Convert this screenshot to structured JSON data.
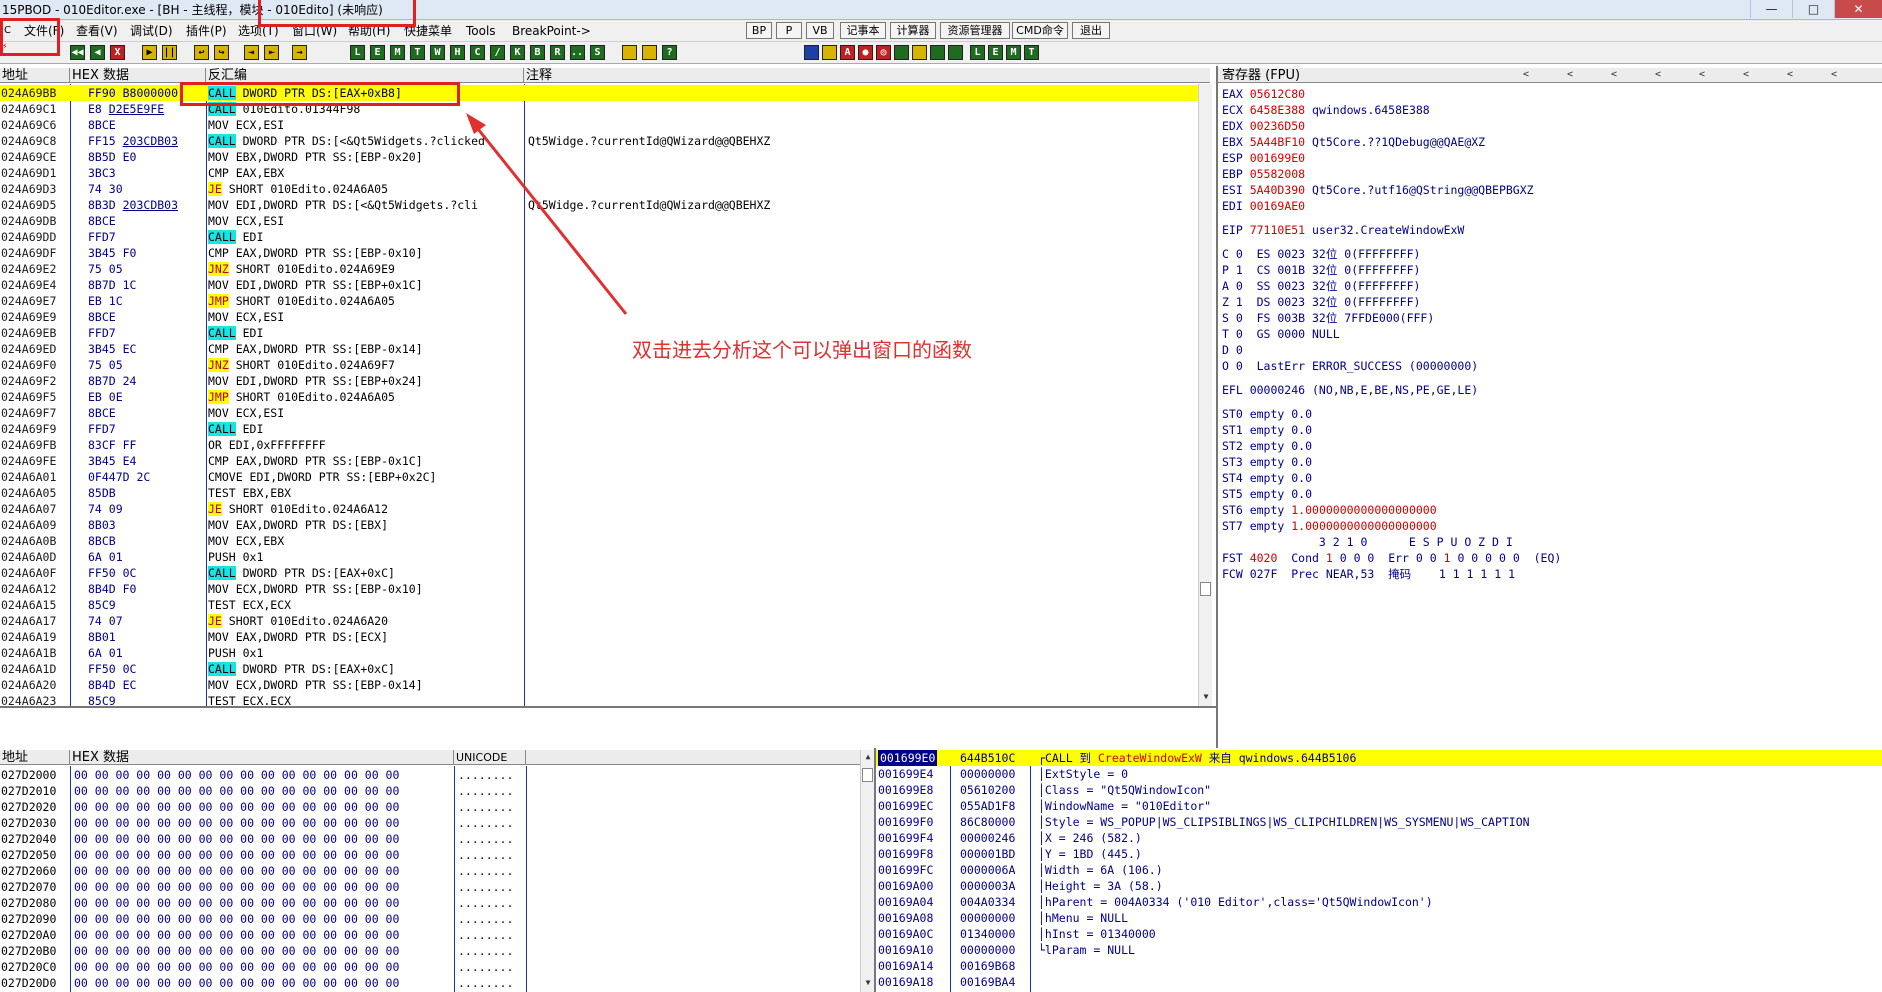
{
  "titlebar": {
    "app": "15PBOD",
    "text": " - 010Editor.exe - [BH - 主线程，模块 - 010Edito] (未响应)",
    "win_min": "—",
    "win_max": "□",
    "win_close": "✕"
  },
  "menu": {
    "items": [
      "文件(F)",
      "查看(V)",
      "调试(D)",
      "插件(P)",
      "选项(T)",
      "窗口(W)",
      "帮助(H)",
      "快捷菜单",
      "Tools",
      "BreakPoint->"
    ],
    "quick": [
      "BP",
      "P",
      "VB",
      "记事本",
      "计算器",
      "资源管理器",
      "CMD命令",
      "退出"
    ]
  },
  "toolbar": {
    "left": [
      "◀◀",
      "◀",
      "X",
      "▶",
      "||",
      "↩",
      "↪",
      "⇥",
      "⇤",
      "→"
    ],
    "letters": [
      "L",
      "E",
      "M",
      "T",
      "W",
      "H",
      "C",
      "/",
      "K",
      "B",
      "R",
      "...",
      "S"
    ]
  },
  "cpu": {
    "headers": {
      "addr": "地址",
      "hex": "HEX 数据",
      "asm": "反汇编",
      "cmt": "注释"
    },
    "rows": [
      {
        "a": "024A69BB",
        "h": "FF90 B8000000",
        "p": "CALL",
        "r": " DWORD PTR DS:[EAX+0xB8]",
        "c": "",
        "sel": true
      },
      {
        "a": "024A69C1",
        "h": "E8 D2E5E9FE",
        "p": "CALL",
        "r": " 010Edito.01344F98",
        "c": ""
      },
      {
        "a": "024A69C6",
        "h": "8BCE",
        "p": "",
        "r": "MOV ECX,ESI",
        "c": ""
      },
      {
        "a": "024A69C8",
        "h": "FF15 203CDB03",
        "p": "CALL",
        "r": " DWORD PTR DS:[<&Qt5Widgets.?clicked",
        "c": "Qt5Widge.?currentId@QWizard@@QBEHXZ"
      },
      {
        "a": "024A69CE",
        "h": "8B5D E0",
        "p": "",
        "r": "MOV EBX,DWORD PTR SS:[EBP-0x20]",
        "c": ""
      },
      {
        "a": "024A69D1",
        "h": "3BC3",
        "p": "",
        "r": "CMP EAX,EBX",
        "c": ""
      },
      {
        "a": "024A69D3",
        "h": "74 30",
        "p": "JE",
        "r": " SHORT 010Edito.024A6A05",
        "c": ""
      },
      {
        "a": "024A69D5",
        "h": "8B3D 203CDB03",
        "p": "",
        "r": "MOV EDI,DWORD PTR DS:[<&Qt5Widgets.?cli",
        "c": "Qt5Widge.?currentId@QWizard@@QBEHXZ"
      },
      {
        "a": "024A69DB",
        "h": "8BCE",
        "p": "",
        "r": "MOV ECX,ESI",
        "c": ""
      },
      {
        "a": "024A69DD",
        "h": "FFD7",
        "p": "CALL",
        "r": " EDI",
        "c": ""
      },
      {
        "a": "024A69DF",
        "h": "3B45 F0",
        "p": "",
        "r": "CMP EAX,DWORD PTR SS:[EBP-0x10]",
        "c": ""
      },
      {
        "a": "024A69E2",
        "h": "75 05",
        "p": "JNZ",
        "r": " SHORT 010Edito.024A69E9",
        "c": ""
      },
      {
        "a": "024A69E4",
        "h": "8B7D 1C",
        "p": "",
        "r": "MOV EDI,DWORD PTR SS:[EBP+0x1C]",
        "c": ""
      },
      {
        "a": "024A69E7",
        "h": "EB 1C",
        "p": "JMP",
        "r": " SHORT 010Edito.024A6A05",
        "c": ""
      },
      {
        "a": "024A69E9",
        "h": "8BCE",
        "p": "",
        "r": "MOV ECX,ESI",
        "c": ""
      },
      {
        "a": "024A69EB",
        "h": "FFD7",
        "p": "CALL",
        "r": " EDI",
        "c": ""
      },
      {
        "a": "024A69ED",
        "h": "3B45 EC",
        "p": "",
        "r": "CMP EAX,DWORD PTR SS:[EBP-0x14]",
        "c": ""
      },
      {
        "a": "024A69F0",
        "h": "75 05",
        "p": "JNZ",
        "r": " SHORT 010Edito.024A69F7",
        "c": ""
      },
      {
        "a": "024A69F2",
        "h": "8B7D 24",
        "p": "",
        "r": "MOV EDI,DWORD PTR SS:[EBP+0x24]",
        "c": ""
      },
      {
        "a": "024A69F5",
        "h": "EB 0E",
        "p": "JMP",
        "r": " SHORT 010Edito.024A6A05",
        "c": ""
      },
      {
        "a": "024A69F7",
        "h": "8BCE",
        "p": "",
        "r": "MOV ECX,ESI",
        "c": ""
      },
      {
        "a": "024A69F9",
        "h": "FFD7",
        "p": "CALL",
        "r": " EDI",
        "c": ""
      },
      {
        "a": "024A69FB",
        "h": "83CF FF",
        "p": "",
        "r": "OR EDI,0xFFFFFFFF",
        "c": ""
      },
      {
        "a": "024A69FE",
        "h": "3B45 E4",
        "p": "",
        "r": "CMP EAX,DWORD PTR SS:[EBP-0x1C]",
        "c": ""
      },
      {
        "a": "024A6A01",
        "h": "0F447D 2C",
        "p": "",
        "r": "CMOVE EDI,DWORD PTR SS:[EBP+0x2C]",
        "c": ""
      },
      {
        "a": "024A6A05",
        "h": "85DB",
        "p": "",
        "r": "TEST EBX,EBX",
        "c": ""
      },
      {
        "a": "024A6A07",
        "h": "74 09",
        "p": "JE",
        "r": " SHORT 010Edito.024A6A12",
        "c": ""
      },
      {
        "a": "024A6A09",
        "h": "8B03",
        "p": "",
        "r": "MOV EAX,DWORD PTR DS:[EBX]",
        "c": ""
      },
      {
        "a": "024A6A0B",
        "h": "8BCB",
        "p": "",
        "r": "MOV ECX,EBX",
        "c": ""
      },
      {
        "a": "024A6A0D",
        "h": "6A 01",
        "p": "",
        "r": "PUSH 0x1",
        "c": ""
      },
      {
        "a": "024A6A0F",
        "h": "FF50 0C",
        "p": "CALL",
        "r": " DWORD PTR DS:[EAX+0xC]",
        "c": ""
      },
      {
        "a": "024A6A12",
        "h": "8B4D F0",
        "p": "",
        "r": "MOV ECX,DWORD PTR SS:[EBP-0x10]",
        "c": ""
      },
      {
        "a": "024A6A15",
        "h": "85C9",
        "p": "",
        "r": "TEST ECX,ECX",
        "c": ""
      },
      {
        "a": "024A6A17",
        "h": "74 07",
        "p": "JE",
        "r": " SHORT 010Edito.024A6A20",
        "c": ""
      },
      {
        "a": "024A6A19",
        "h": "8B01",
        "p": "",
        "r": "MOV EAX,DWORD PTR DS:[ECX]",
        "c": ""
      },
      {
        "a": "024A6A1B",
        "h": "6A 01",
        "p": "",
        "r": "PUSH 0x1",
        "c": ""
      },
      {
        "a": "024A6A1D",
        "h": "FF50 0C",
        "p": "CALL",
        "r": " DWORD PTR DS:[EAX+0xC]",
        "c": ""
      },
      {
        "a": "024A6A20",
        "h": "8B4D EC",
        "p": "",
        "r": "MOV ECX,DWORD PTR SS:[EBP-0x14]",
        "c": ""
      },
      {
        "a": "024A6A23",
        "h": "85C9",
        "p": "",
        "r": "TEST ECX,ECX",
        "c": ""
      }
    ]
  },
  "annotation": "双击进去分析这个可以弹出窗口的函数",
  "registers": {
    "title": "寄存器 (FPU)",
    "nav": [
      "<",
      "<",
      "<",
      "<",
      "<",
      "<",
      "<",
      "<"
    ],
    "gp": [
      {
        "n": "EAX",
        "v": "05612C80",
        "d": ""
      },
      {
        "n": "ECX",
        "v": "6458E388",
        "d": "qwindows.6458E388"
      },
      {
        "n": "EDX",
        "v": "00236D50",
        "d": ""
      },
      {
        "n": "EBX",
        "v": "5A44BF10",
        "d": "Qt5Core.??1QDebug@@QAE@XZ"
      },
      {
        "n": "ESP",
        "v": "001699E0",
        "d": ""
      },
      {
        "n": "EBP",
        "v": "05582008",
        "d": ""
      },
      {
        "n": "ESI",
        "v": "5A40D390",
        "d": "Qt5Core.?utf16@QString@@QBEPBGXZ"
      },
      {
        "n": "EDI",
        "v": "00169AE0",
        "d": ""
      }
    ],
    "eip": {
      "n": "EIP",
      "v": "77110E51",
      "d": "user32.CreateWindowExW"
    },
    "seg": [
      "C 0  ES 0023 32位 0(FFFFFFFF)",
      "P 1  CS 001B 32位 0(FFFFFFFF)",
      "A 0  SS 0023 32位 0(FFFFFFFF)",
      "Z 1  DS 0023 32位 0(FFFFFFFF)",
      "S 0  FS 003B 32位 7FFDE000(FFF)",
      "T 0  GS 0000 NULL",
      "D 0",
      "O 0  LastErr ERROR_SUCCESS (00000000)"
    ],
    "efl": "EFL 00000246 (NO,NB,E,BE,NS,PE,GE,LE)",
    "fpu": [
      {
        "n": "ST0",
        "s": "empty",
        "v": "0.0",
        "red": false
      },
      {
        "n": "ST1",
        "s": "empty",
        "v": "0.0",
        "red": false
      },
      {
        "n": "ST2",
        "s": "empty",
        "v": "0.0",
        "red": false
      },
      {
        "n": "ST3",
        "s": "empty",
        "v": "0.0",
        "red": false
      },
      {
        "n": "ST4",
        "s": "empty",
        "v": "0.0",
        "red": false
      },
      {
        "n": "ST5",
        "s": "empty",
        "v": "0.0",
        "red": false
      },
      {
        "n": "ST6",
        "s": "empty",
        "v": "1.0000000000000000000",
        "red": true
      },
      {
        "n": "ST7",
        "s": "empty",
        "v": "1.0000000000000000000",
        "red": true
      }
    ],
    "fbits": "              3 2 1 0      E S P U O Z D I",
    "fst": {
      "pre": "FST ",
      "v": "4020",
      "mid": "  Cond ",
      "c1": "1",
      "c2": " 0 0 0  Err 0 0 ",
      "c3": "1",
      "c4": " 0 0 0 0 0  (EQ)"
    },
    "fcw": {
      "pre": "FCW 027F  Prec NEAR,53  ",
      "mask": "掩码",
      "post": "    1 1 1 1 1 1"
    }
  },
  "dump": {
    "headers": {
      "addr": "地址",
      "hex": "HEX 数据",
      "uni": "UNICODE"
    },
    "addrs": [
      "027D2000",
      "027D2010",
      "027D2020",
      "027D2030",
      "027D2040",
      "027D2050",
      "027D2060",
      "027D2070",
      "027D2080",
      "027D2090",
      "027D20A0",
      "027D20B0",
      "027D20C0",
      "027D20D0"
    ],
    "bytes": "00 00 00 00 00 00 00 00 00 00 00 00 00 00 00 00",
    "uni": "........"
  },
  "stack": {
    "rows": [
      {
        "a": "001699E0",
        "v": "644B510C",
        "c": "CALL 到 CreateWindowExW 来自 qwindows.644B5106",
        "sel": true
      },
      {
        "a": "001699E4",
        "v": "00000000",
        "c": "ExtStyle = 0"
      },
      {
        "a": "001699E8",
        "v": "05610200",
        "c": "Class = \"Qt5QWindowIcon\""
      },
      {
        "a": "001699EC",
        "v": "055AD1F8",
        "c": "WindowName = \"010Editor\""
      },
      {
        "a": "001699F0",
        "v": "86C80000",
        "c": "Style = WS_POPUP|WS_CLIPSIBLINGS|WS_CLIPCHILDREN|WS_SYSMENU|WS_CAPTION"
      },
      {
        "a": "001699F4",
        "v": "00000246",
        "c": "X = 246 (582.)"
      },
      {
        "a": "001699F8",
        "v": "000001BD",
        "c": "Y = 1BD (445.)"
      },
      {
        "a": "001699FC",
        "v": "0000006A",
        "c": "Width = 6A (106.)"
      },
      {
        "a": "00169A00",
        "v": "0000003A",
        "c": "Height = 3A (58.)"
      },
      {
        "a": "00169A04",
        "v": "004A0334",
        "c": "hParent = 004A0334 ('010 Editor',class='Qt5QWindowIcon')"
      },
      {
        "a": "00169A08",
        "v": "00000000",
        "c": "hMenu = NULL"
      },
      {
        "a": "00169A0C",
        "v": "01340000",
        "c": "hInst = 01340000"
      },
      {
        "a": "00169A10",
        "v": "00000000",
        "c": "lParam = NULL"
      },
      {
        "a": "00169A14",
        "v": "00169B68",
        "c": ""
      },
      {
        "a": "00169A18",
        "v": "00169BA4",
        "c": ""
      }
    ]
  }
}
